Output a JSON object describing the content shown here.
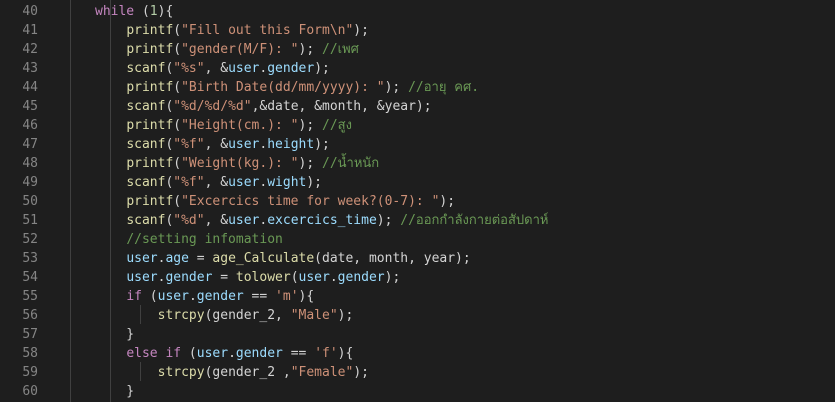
{
  "editor": {
    "lines": [
      {
        "n": "40",
        "t": [
          [
            "kw",
            "while"
          ],
          [
            "p",
            " ("
          ],
          [
            "num",
            "1"
          ],
          [
            "p",
            "){"
          ]
        ]
      },
      {
        "n": "41",
        "t": [
          [
            "p",
            "    "
          ],
          [
            "fn",
            "printf"
          ],
          [
            "p",
            "("
          ],
          [
            "str",
            "\"Fill out this Form\\n\""
          ],
          [
            "p",
            ");"
          ]
        ]
      },
      {
        "n": "42",
        "t": [
          [
            "p",
            "    "
          ],
          [
            "fn",
            "printf"
          ],
          [
            "p",
            "("
          ],
          [
            "str",
            "\"gender(M/F): \""
          ],
          [
            "p",
            "); "
          ],
          [
            "cm",
            "//เพศ"
          ]
        ]
      },
      {
        "n": "43",
        "t": [
          [
            "p",
            "    "
          ],
          [
            "fn",
            "scanf"
          ],
          [
            "p",
            "("
          ],
          [
            "str",
            "\"%s\""
          ],
          [
            "p",
            ", &"
          ],
          [
            "var",
            "user"
          ],
          [
            "p",
            "."
          ],
          [
            "var",
            "gender"
          ],
          [
            "p",
            ");"
          ]
        ]
      },
      {
        "n": "44",
        "t": [
          [
            "p",
            "    "
          ],
          [
            "fn",
            "printf"
          ],
          [
            "p",
            "("
          ],
          [
            "str",
            "\"Birth Date(dd/mm/yyyy): \""
          ],
          [
            "p",
            "); "
          ],
          [
            "cm",
            "//อายุ คศ."
          ]
        ]
      },
      {
        "n": "45",
        "t": [
          [
            "p",
            "    "
          ],
          [
            "fn",
            "scanf"
          ],
          [
            "p",
            "("
          ],
          [
            "str",
            "\"%d/%d/%d\""
          ],
          [
            "p",
            ",&date, &month, &year);"
          ]
        ]
      },
      {
        "n": "46",
        "t": [
          [
            "p",
            "    "
          ],
          [
            "fn",
            "printf"
          ],
          [
            "p",
            "("
          ],
          [
            "str",
            "\"Height(cm.): \""
          ],
          [
            "p",
            "); "
          ],
          [
            "cm",
            "//สูง"
          ]
        ]
      },
      {
        "n": "47",
        "t": [
          [
            "p",
            "    "
          ],
          [
            "fn",
            "scanf"
          ],
          [
            "p",
            "("
          ],
          [
            "str",
            "\"%f\""
          ],
          [
            "p",
            ", &"
          ],
          [
            "var",
            "user"
          ],
          [
            "p",
            "."
          ],
          [
            "var",
            "height"
          ],
          [
            "p",
            ");"
          ]
        ]
      },
      {
        "n": "48",
        "t": [
          [
            "p",
            "    "
          ],
          [
            "fn",
            "printf"
          ],
          [
            "p",
            "("
          ],
          [
            "str",
            "\"Weight(kg.): \""
          ],
          [
            "p",
            "); "
          ],
          [
            "cm",
            "//น้ำหนัก"
          ]
        ]
      },
      {
        "n": "49",
        "t": [
          [
            "p",
            "    "
          ],
          [
            "fn",
            "scanf"
          ],
          [
            "p",
            "("
          ],
          [
            "str",
            "\"%f\""
          ],
          [
            "p",
            ", &"
          ],
          [
            "var",
            "user"
          ],
          [
            "p",
            "."
          ],
          [
            "var",
            "wight"
          ],
          [
            "p",
            ");"
          ]
        ]
      },
      {
        "n": "50",
        "t": [
          [
            "p",
            "    "
          ],
          [
            "fn",
            "printf"
          ],
          [
            "p",
            "("
          ],
          [
            "str",
            "\"Excercics time for week?(0-7): \""
          ],
          [
            "p",
            ");"
          ]
        ]
      },
      {
        "n": "51",
        "t": [
          [
            "p",
            "    "
          ],
          [
            "fn",
            "scanf"
          ],
          [
            "p",
            "("
          ],
          [
            "str",
            "\"%d\""
          ],
          [
            "p",
            ", &"
          ],
          [
            "var",
            "user"
          ],
          [
            "p",
            "."
          ],
          [
            "var",
            "excercics_time"
          ],
          [
            "p",
            "); "
          ],
          [
            "cm",
            "//ออกกำลังกายต่อสัปดาห์"
          ]
        ]
      },
      {
        "n": "52",
        "t": [
          [
            "p",
            "    "
          ],
          [
            "cm",
            "//setting infomation"
          ]
        ]
      },
      {
        "n": "53",
        "t": [
          [
            "p",
            "    "
          ],
          [
            "var",
            "user"
          ],
          [
            "p",
            "."
          ],
          [
            "var",
            "age"
          ],
          [
            "p",
            " = "
          ],
          [
            "fn",
            "age_Calculate"
          ],
          [
            "p",
            "(date, month, year);"
          ]
        ]
      },
      {
        "n": "54",
        "t": [
          [
            "p",
            "    "
          ],
          [
            "var",
            "user"
          ],
          [
            "p",
            "."
          ],
          [
            "var",
            "gender"
          ],
          [
            "p",
            " = "
          ],
          [
            "fn",
            "tolower"
          ],
          [
            "p",
            "("
          ],
          [
            "var",
            "user"
          ],
          [
            "p",
            "."
          ],
          [
            "var",
            "gender"
          ],
          [
            "p",
            ");"
          ]
        ]
      },
      {
        "n": "55",
        "t": [
          [
            "p",
            "    "
          ],
          [
            "kw",
            "if"
          ],
          [
            "p",
            " ("
          ],
          [
            "var",
            "user"
          ],
          [
            "p",
            "."
          ],
          [
            "var",
            "gender"
          ],
          [
            "p",
            " == "
          ],
          [
            "str",
            "'m'"
          ],
          [
            "p",
            "){"
          ]
        ]
      },
      {
        "n": "56",
        "t": [
          [
            "p",
            "        "
          ],
          [
            "fn",
            "strcpy"
          ],
          [
            "p",
            "(gender_2, "
          ],
          [
            "str",
            "\"Male\""
          ],
          [
            "p",
            ");"
          ]
        ]
      },
      {
        "n": "57",
        "t": [
          [
            "p",
            "    }"
          ]
        ]
      },
      {
        "n": "58",
        "t": [
          [
            "p",
            "    "
          ],
          [
            "kw",
            "else"
          ],
          [
            "p",
            " "
          ],
          [
            "kw",
            "if"
          ],
          [
            "p",
            " ("
          ],
          [
            "var",
            "user"
          ],
          [
            "p",
            "."
          ],
          [
            "var",
            "gender"
          ],
          [
            "p",
            " == "
          ],
          [
            "str",
            "'f'"
          ],
          [
            "p",
            "){"
          ]
        ]
      },
      {
        "n": "59",
        "t": [
          [
            "p",
            "        "
          ],
          [
            "fn",
            "strcpy"
          ],
          [
            "p",
            "(gender_2 ,"
          ],
          [
            "str",
            "\"Female\""
          ],
          [
            "p",
            ");"
          ]
        ]
      },
      {
        "n": "60",
        "t": [
          [
            "p",
            "    }"
          ]
        ]
      }
    ]
  }
}
